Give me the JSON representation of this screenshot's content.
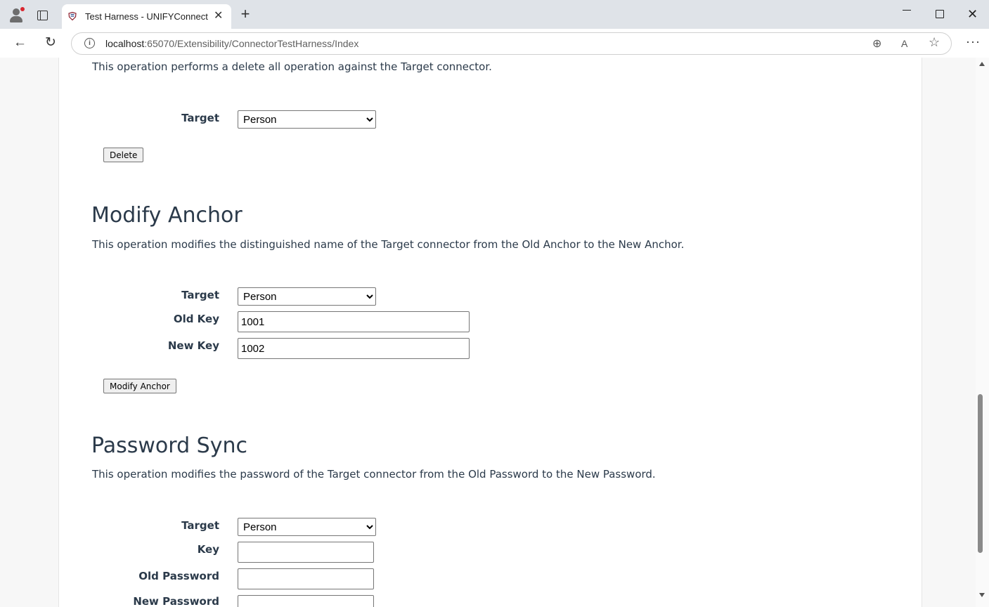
{
  "browser": {
    "tab_title": "Test Harness - UNIFYConnect",
    "tab_close": "✕",
    "new_tab": "+",
    "url_host": "localhost",
    "url_rest": ":65070/Extensibility/ConnectorTestHarness/Index",
    "info_glyph": "i",
    "back_glyph": "←",
    "reload_glyph": "↻",
    "zoom_glyph": "⊕",
    "read_glyph": "A",
    "fav_glyph": "☆",
    "more_glyph": "···",
    "close_glyph": "✕"
  },
  "delete_all": {
    "description": "This operation performs a delete all operation against the Target connector.",
    "target_label": "Target",
    "target_value": "Person",
    "button": "Delete"
  },
  "modify_anchor": {
    "title": "Modify Anchor",
    "description": "This operation modifies the distinguished name of the Target connector from the Old Anchor to the New Anchor.",
    "target_label": "Target",
    "target_value": "Person",
    "old_key_label": "Old Key",
    "old_key_value": "1001",
    "new_key_label": "New Key",
    "new_key_value": "1002",
    "button": "Modify Anchor"
  },
  "password_sync": {
    "title": "Password Sync",
    "description": "This operation modifies the password of the Target connector from the Old Password to the New Password.",
    "target_label": "Target",
    "target_value": "Person",
    "key_label": "Key",
    "key_value": "",
    "old_password_label": "Old Password",
    "old_password_value": "",
    "new_password_label": "New Password",
    "new_password_value": ""
  }
}
